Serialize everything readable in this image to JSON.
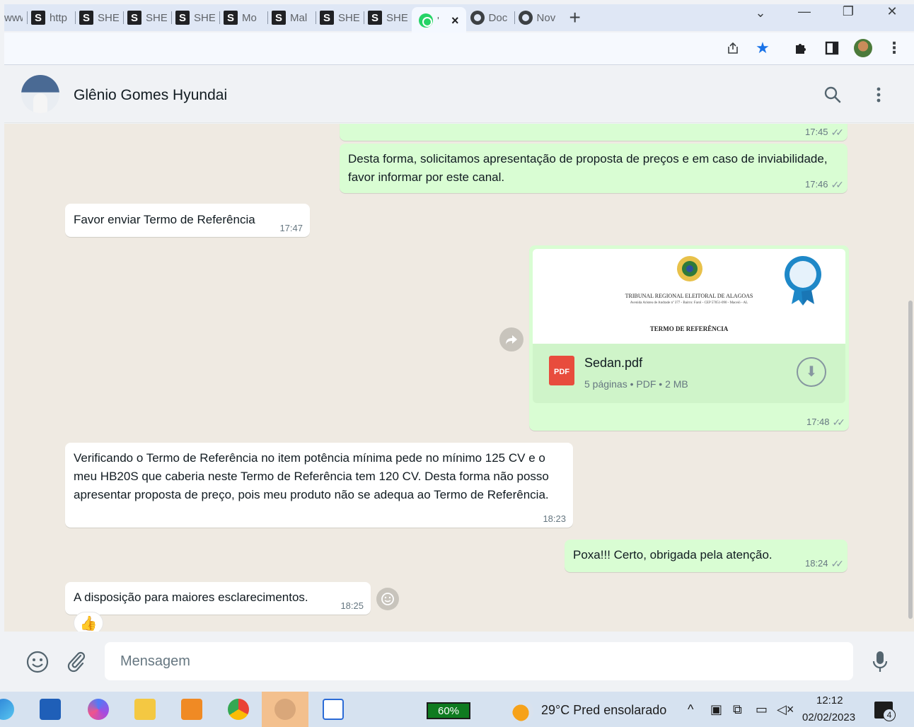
{
  "browser": {
    "tabs": [
      {
        "favicon": "",
        "title": "www"
      },
      {
        "favicon": "S",
        "title": "http"
      },
      {
        "favicon": "S",
        "title": "SHE"
      },
      {
        "favicon": "S",
        "title": "SHE"
      },
      {
        "favicon": "S",
        "title": "SHE"
      },
      {
        "favicon": "S",
        "title": "Mo"
      },
      {
        "favicon": "S",
        "title": "Mal"
      },
      {
        "favicon": "S",
        "title": "SHE"
      },
      {
        "favicon": "S",
        "title": "SHE"
      }
    ],
    "active_tab": {
      "title": "'",
      "close": "×",
      "icon": "whatsapp-icon"
    },
    "after_tabs": [
      {
        "title": "Doc",
        "icon": "chrome-icon"
      },
      {
        "title": "Nov",
        "icon": "chrome-icon"
      }
    ],
    "new_tab": "+",
    "window_controls": {
      "tab_search": "⌄",
      "minimize": "—",
      "restore": "❐",
      "close": "✕"
    },
    "toolbar_icons": [
      "share-icon",
      "bookmark-star-icon",
      "extensions-puzzle-icon",
      "side-panel-icon",
      "profile-avatar-icon",
      "more-vert-icon"
    ]
  },
  "header": {
    "contact_name": "Glênio Gomes Hyundai"
  },
  "messages": [
    {
      "dir": "out",
      "text": "",
      "time": "17:45"
    },
    {
      "dir": "out",
      "text": "Desta forma, solicitamos apresentação de proposta de preços e em caso de inviabilidade, favor informar por este canal.",
      "time": "17:46"
    },
    {
      "dir": "in",
      "text": "Favor enviar Termo de Referência",
      "time": "17:47"
    },
    {
      "dir": "out",
      "type": "document",
      "file_name": "Sedan.pdf",
      "file_info": "5 páginas • PDF • 2 MB",
      "file_badge": "PDF",
      "preview": {
        "org": "TRIBUNAL REGIONAL ELEITORAL DE ALAGOAS",
        "address": "Avenida Aristeu de Andrade nº 377 - Bairro: Farol - CEP 57051-090 - Maceió - AL",
        "doc_title": "TERMO DE REFERÊNCIA"
      },
      "time": "17:48"
    },
    {
      "dir": "in",
      "text": "Verificando o Termo de Referência no item potência mínima pede no mínimo 125 CV e o meu HB20S que caberia neste Termo de Referência tem 120 CV. Desta forma não posso apresentar proposta de preço, pois meu produto não se adequa ao Termo de Referência.",
      "time": "18:23"
    },
    {
      "dir": "out",
      "text": "Poxa!!! Certo, obrigada pela atenção.",
      "time": "18:24"
    },
    {
      "dir": "in",
      "text": "A disposição para maiores esclarecimentos.",
      "time": "18:25",
      "reaction": "👍"
    }
  ],
  "compose": {
    "placeholder": "Mensagem"
  },
  "taskbar": {
    "battery": "60%",
    "weather": "29°C  Pred ensolarado",
    "time": "12:12",
    "date": "02/02/2023",
    "notifications": "4"
  }
}
